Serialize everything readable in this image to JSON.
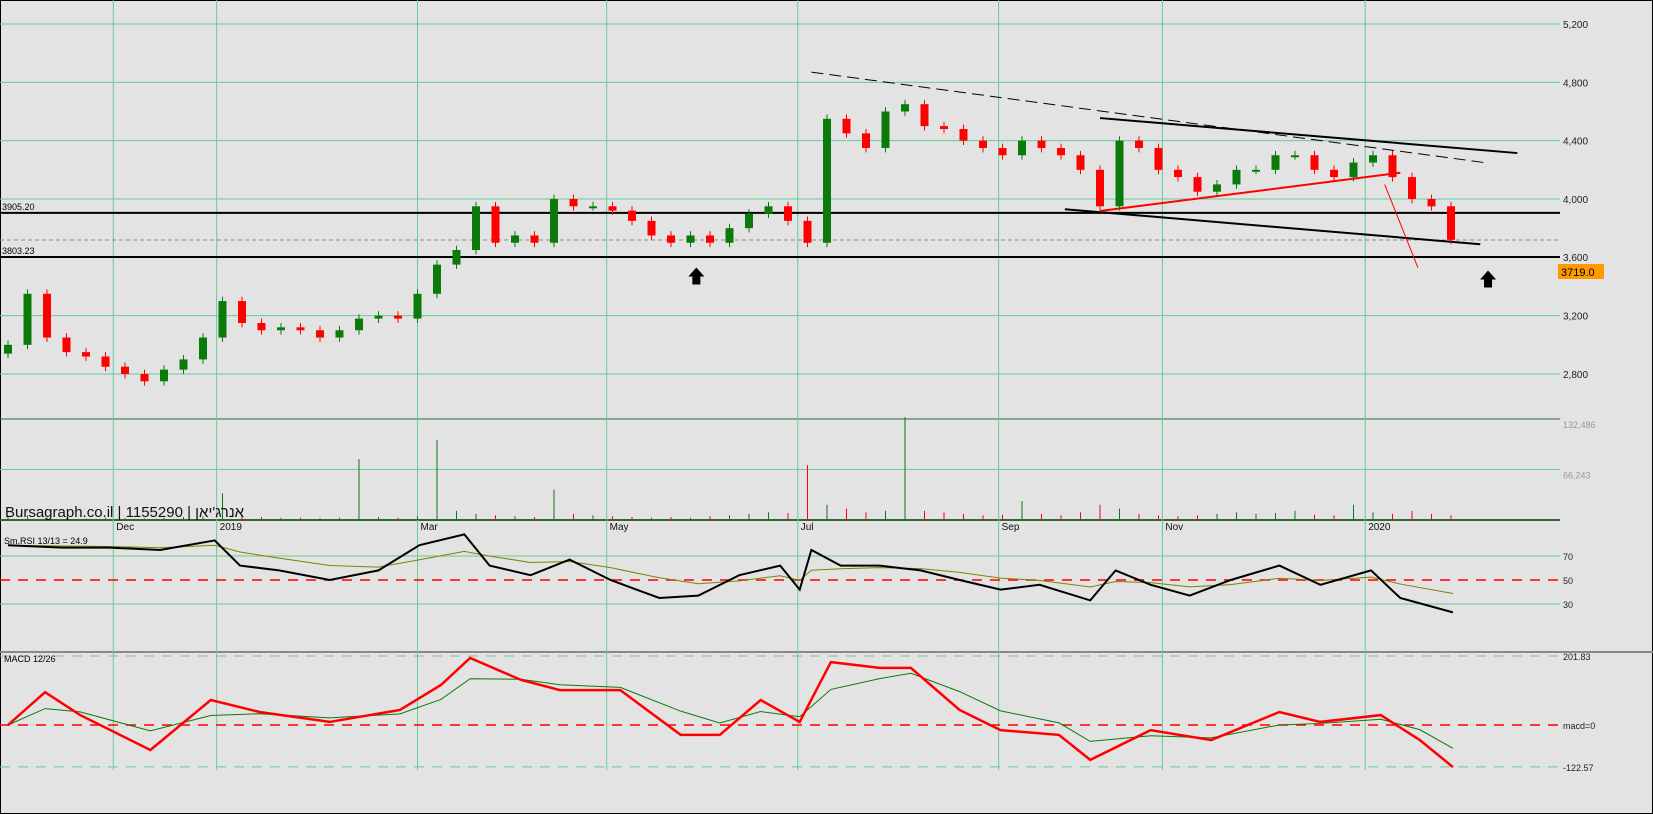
{
  "watermark": "Bursagraph.co.il | 1155290 | אנרג'יאן",
  "last_price_label": "3719.0",
  "colors": {
    "up": "#0a7a0a",
    "down": "#ff0000",
    "grid": "#66cc99",
    "bg": "#e3e3e3",
    "accent": "#ff9900"
  },
  "chart_data": [
    {
      "type": "candlestick",
      "title": "Bursagraph.co.il | 1155290 | אנרג'יאן",
      "ylim": [
        2700,
        5250
      ],
      "y_ticks": [
        "5,200",
        "4,800",
        "4,400",
        "4,000",
        "3,600",
        "3,200",
        "2,800"
      ],
      "y_tick_values": [
        5200,
        4800,
        4400,
        4000,
        3600,
        3200,
        2800
      ],
      "x_tick_labels": [
        "Dec",
        "2019",
        "Mar",
        "May",
        "Jul",
        "Sep",
        "Nov",
        "2020"
      ],
      "x_tick_index": [
        5.4,
        10.7,
        21,
        30.7,
        40.5,
        50.8,
        59.2,
        69.6
      ],
      "grid": true,
      "closes": [
        3000,
        3350,
        3050,
        2950,
        2920,
        2850,
        2800,
        2750,
        2830,
        2900,
        3050,
        3300,
        3150,
        3100,
        3120,
        3100,
        3050,
        3100,
        3180,
        3200,
        3180,
        3350,
        3550,
        3650,
        3950,
        3700,
        3750,
        3700,
        4000,
        3950,
        3950,
        3920,
        3850,
        3750,
        3700,
        3750,
        3700,
        3800,
        3900,
        3950,
        3850,
        3700,
        4550,
        4450,
        4350,
        4600,
        4650,
        4500,
        4480,
        4400,
        4350,
        4300,
        4400,
        4350,
        4300,
        4200,
        3950,
        4400,
        4350,
        4200,
        4150,
        4050,
        4100,
        4200,
        4200,
        4300,
        4300,
        4200,
        4150,
        4250,
        4300,
        4150,
        4000,
        3950,
        3720
      ],
      "level_labels": [
        {
          "value": 3905.2,
          "label": "3905.20"
        },
        {
          "value": 3603.23,
          "label": "3803.23"
        }
      ],
      "last_value": 3719,
      "trendlines": [
        {
          "style": "black-thick",
          "from": [
            56,
            4555
          ],
          "to": [
            77.4,
            4315
          ]
        },
        {
          "style": "black-thick",
          "from": [
            54.2,
            3930
          ],
          "to": [
            75.5,
            3690
          ]
        },
        {
          "style": "black-dashed",
          "from": [
            41.2,
            4870
          ],
          "to": [
            75.7,
            4250
          ]
        },
        {
          "style": "red",
          "from": [
            56,
            3918
          ],
          "to": [
            71.4,
            4180
          ]
        },
        {
          "style": "red-thin",
          "from": [
            70.6,
            4100
          ],
          "to": [
            72.3,
            3530
          ]
        }
      ],
      "arrows": [
        {
          "index": 35.3,
          "value": 3530
        },
        {
          "index": 75.9,
          "value": 3510
        }
      ]
    },
    {
      "type": "bar",
      "name": "Volume",
      "y_ticks": [
        "132,486",
        "66,243"
      ],
      "y_tick_values": [
        132486,
        66243
      ],
      "values": [
        4000,
        6000,
        3000,
        2500,
        2000,
        3000,
        2500,
        2000,
        3000,
        4000,
        5000,
        35000,
        6000,
        4000,
        3000,
        3000,
        2500,
        3000,
        80000,
        4000,
        3000,
        5000,
        105000,
        12000,
        8000,
        6000,
        5000,
        4000,
        40000,
        8000,
        6000,
        5000,
        4000,
        3000,
        4000,
        3000,
        5000,
        6000,
        8000,
        10000,
        9000,
        72000,
        20000,
        15000,
        10000,
        12000,
        140000,
        12000,
        10000,
        8000,
        6000,
        7000,
        25000,
        8000,
        6000,
        10000,
        20000,
        15000,
        8000,
        6000,
        5000,
        6000,
        8000,
        10000,
        8000,
        9000,
        12000,
        7000,
        6000,
        20000,
        10000,
        8000,
        12000,
        8000,
        6000
      ]
    },
    {
      "type": "line",
      "name": "Sm.RSI",
      "label": "Sm.RSI 13/13 = 24.9",
      "y_ticks": [
        "70",
        "50",
        "30"
      ],
      "y_tick_values": [
        70,
        50,
        30
      ],
      "x": [
        0,
        2.8,
        5.2,
        7.8,
        10.6,
        11.9,
        13.9,
        16.5,
        19,
        21.1,
        23.4,
        24.7,
        26.8,
        28.8,
        30.9,
        33.4,
        35.4,
        37.5,
        39.6,
        40.6,
        41.2,
        42.7,
        44.7,
        46.8,
        48.8,
        50.9,
        52.9,
        55.5,
        56.8,
        58.6,
        60.6,
        62.7,
        65.2,
        67.3,
        69.9,
        71.4,
        74.1
      ],
      "values": [
        79,
        77,
        77,
        75,
        83,
        62,
        58,
        50,
        58,
        79,
        88,
        62,
        54,
        67,
        50,
        35,
        37,
        54,
        62,
        42,
        75,
        62,
        62,
        58,
        50,
        42,
        46,
        33,
        58,
        46,
        37,
        50,
        62,
        46,
        58,
        35,
        23
      ]
    },
    {
      "type": "line",
      "name": "MACD",
      "label": "MACD 12/26",
      "y_ticks": [
        "201.83",
        "macd=0",
        "-122.57"
      ],
      "y_tick_values": [
        201.83,
        0,
        -122.57
      ],
      "x": [
        0,
        1.9,
        3.7,
        7.3,
        10.4,
        12.9,
        16.5,
        20.1,
        22.2,
        23.7,
        26.3,
        28.3,
        31.4,
        34.5,
        36.5,
        38.6,
        40.6,
        42.2,
        44.7,
        46.3,
        48.8,
        50.9,
        53.9,
        55.5,
        58.6,
        61.7,
        65.2,
        67.3,
        70.4,
        72.4,
        74.1
      ],
      "values": [
        0,
        96,
        29,
        -73,
        73,
        38,
        9,
        44,
        117,
        196,
        132,
        102,
        102,
        -29,
        -29,
        73,
        9,
        184,
        167,
        167,
        44,
        -15,
        -29,
        -102,
        -15,
        -44,
        38,
        9,
        29,
        -44,
        -123
      ]
    }
  ]
}
